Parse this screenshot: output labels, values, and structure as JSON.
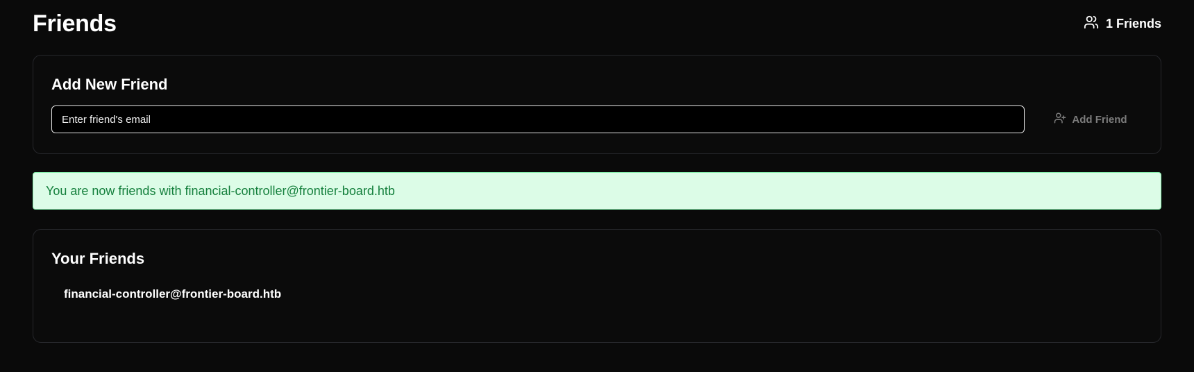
{
  "header": {
    "title": "Friends",
    "friend_count_label": "1 Friends"
  },
  "add_friend": {
    "title": "Add New Friend",
    "input_placeholder": "Enter friend's email",
    "input_value": "",
    "button_label": "Add Friend"
  },
  "alert": {
    "message": "You are now friends with financial-controller@frontier-board.htb",
    "colors": {
      "background": "#dcfce7",
      "border": "#86efac",
      "text": "#15803d"
    }
  },
  "friends": {
    "title": "Your Friends",
    "items": [
      {
        "email": "financial-controller@frontier-board.htb"
      }
    ]
  },
  "icons": {
    "friend_count": "users-icon",
    "add_button": "user-plus-icon"
  }
}
